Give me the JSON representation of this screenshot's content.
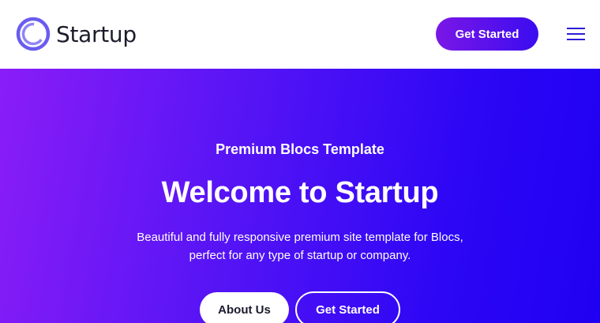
{
  "navbar": {
    "brand_name": "Startup",
    "cta_label": "Get Started",
    "menu_icon": "hamburger-menu-icon"
  },
  "hero": {
    "eyebrow": "Premium Blocs Template",
    "title": "Welcome to Startup",
    "description_line1": "Beautiful and fully responsive premium site template for Blocs,",
    "description_line2": "perfect for any type of startup or company.",
    "primary_button": "About Us",
    "secondary_button": "Get Started"
  },
  "colors": {
    "accent": "#3b0cf0",
    "gradient_start": "#8a1df7",
    "gradient_end": "#2000f2",
    "logo": "#6a5cf0",
    "text_dark": "#1c1c2b",
    "white": "#ffffff"
  }
}
